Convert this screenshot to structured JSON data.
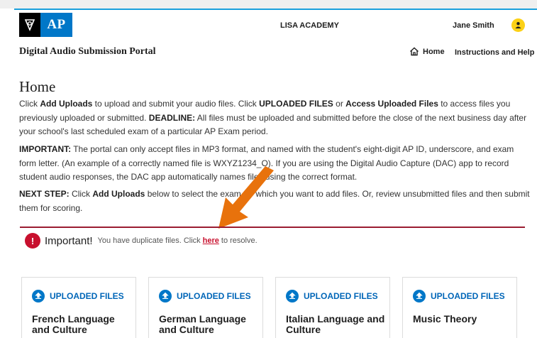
{
  "header": {
    "logo_text": "AP",
    "school_name": "LISA ACADEMY",
    "user_name": "Jane Smith"
  },
  "nav": {
    "portal_title": "Digital Audio Submission Portal",
    "home_label": "Home",
    "help_label": "Instructions and Help"
  },
  "main": {
    "page_title": "Home",
    "p1": {
      "t1": "Click ",
      "b1": "Add Uploads",
      "t2": " to upload and submit your audio files. Click ",
      "b2": "UPLOADED FILES",
      "t3": " or ",
      "b3": "Access Uploaded Files",
      "t4": " to access files you previously uploaded or submitted. ",
      "b4": "DEADLINE:",
      "t5": " All files must be uploaded and submitted before the close of the next business day after your school's last scheduled exam of a particular AP Exam period."
    },
    "p2": {
      "b1": "IMPORTANT:",
      "t1": " The portal can only accept files in MP3 format, and named with the student's eight-digit AP ID, underscore, and exam form letter. (An example of a correctly named file is WXYZ1234_O). If you are using the Digital Audio Capture (DAC) app to record student audio responses, the DAC app automatically names files using the correct format."
    },
    "p3": {
      "b1": "NEXT STEP:",
      "t1": " Click ",
      "b2": "Add Uploads",
      "t2": " below to select the exam for which you want to add files. Or, review unsubmitted files and then submit them for scoring."
    }
  },
  "alert": {
    "icon": "!",
    "title": "Important!",
    "text_before": "You have duplicate files. Click",
    "link": "here",
    "text_after": "to resolve."
  },
  "cards": [
    {
      "link_label": "UPLOADED FILES",
      "title": "French Language and Culture"
    },
    {
      "link_label": "UPLOADED FILES",
      "title": "German Language and Culture"
    },
    {
      "link_label": "UPLOADED FILES",
      "title": "Italian Language and Culture"
    },
    {
      "link_label": "UPLOADED FILES",
      "title": "Music Theory"
    }
  ],
  "colors": {
    "brand_blue": "#0077c8",
    "alert_red": "#c8102e",
    "accent_orange": "#e8720c",
    "user_yellow": "#fcd116"
  },
  "icons": {
    "logo": "ap-torch-logo-icon",
    "user": "user-avatar-icon",
    "home": "home-icon",
    "alert": "exclamation-icon",
    "upload": "upload-icon",
    "annotation": "arrow-annotation-icon"
  }
}
